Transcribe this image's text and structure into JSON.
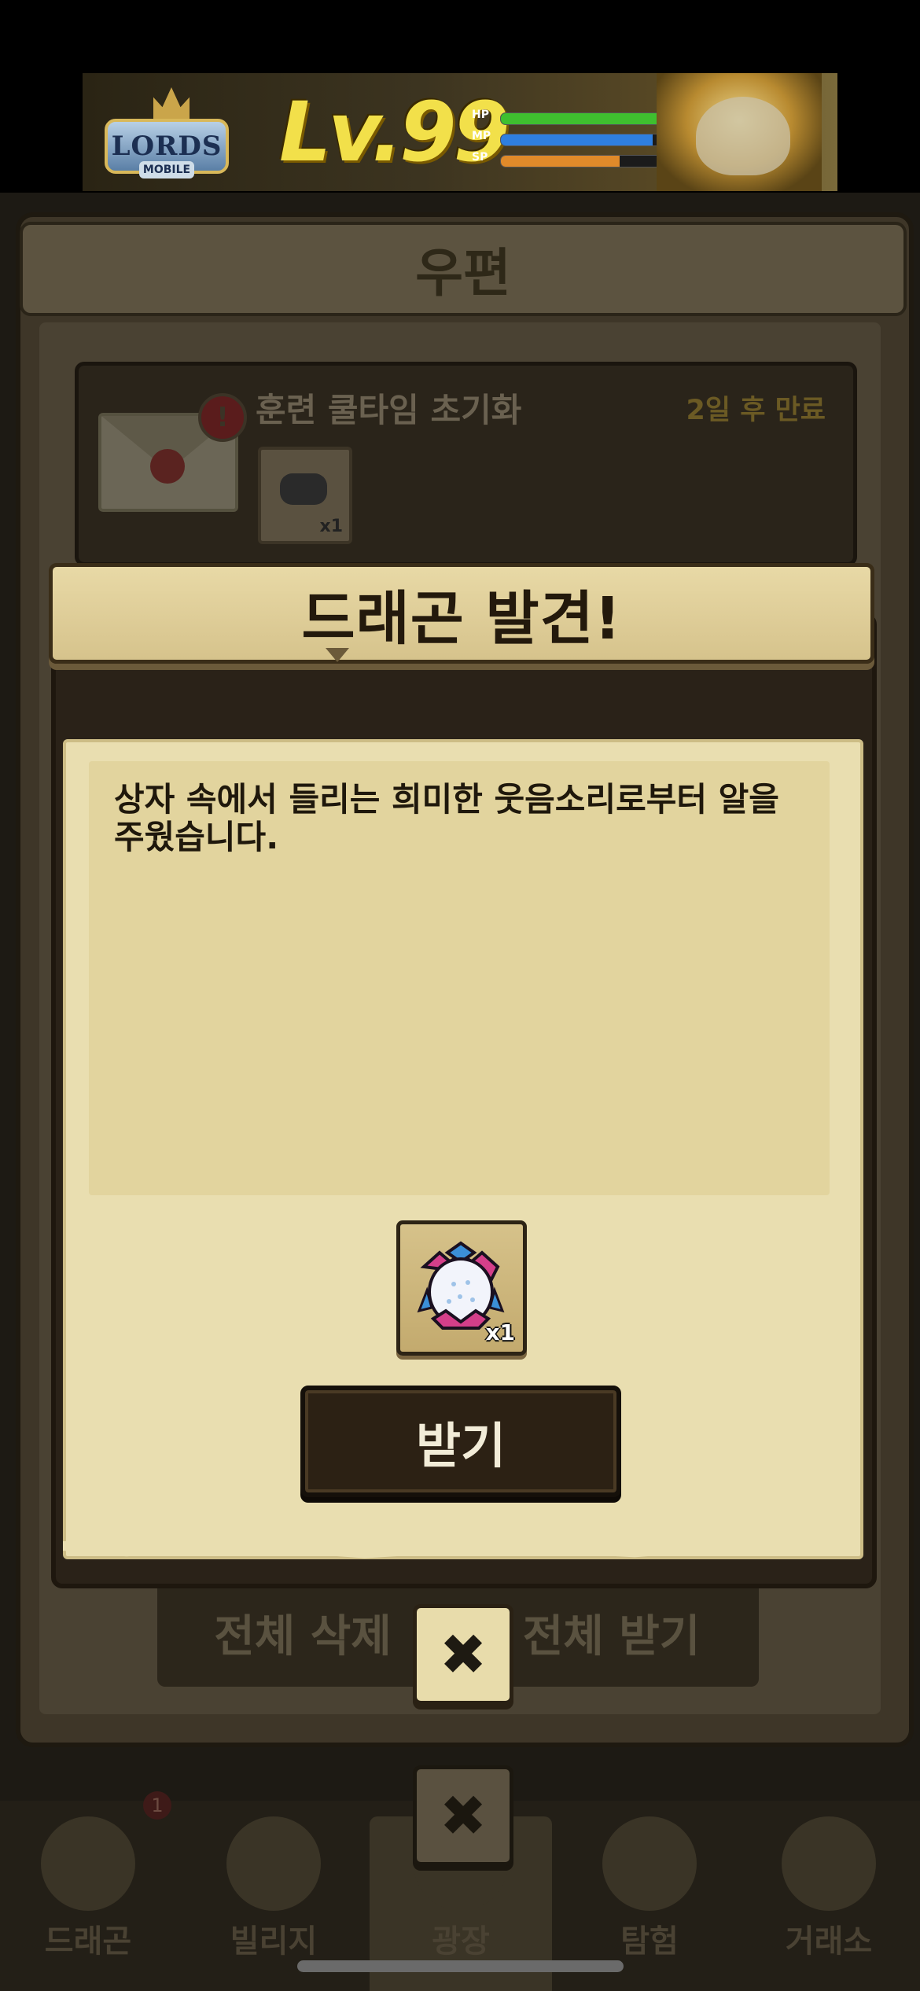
{
  "ad": {
    "logo_text": "LORDS",
    "logo_sub": "MOBILE",
    "level_text": "Lv.99",
    "stats": [
      {
        "label": "HP",
        "fill": 0.95,
        "color": "#3fbf2f"
      },
      {
        "label": "MP",
        "fill": 0.92,
        "color": "#2f7fdf"
      },
      {
        "label": "SP",
        "fill": 0.72,
        "color": "#e08a2a"
      }
    ]
  },
  "mail": {
    "title": "우편",
    "item": {
      "title": "훈련 쿨타임 초기화",
      "expiry": "2일 후 만료",
      "alert_icon": "!",
      "reward_qty": "x1"
    },
    "buttons": {
      "delete_all": "전체 삭제",
      "receive_all": "전체 받기"
    }
  },
  "popup": {
    "title": "드래곤 발견!",
    "message": "상자 속에서 들리는 희미한 웃음소리로부터 알을 주웠습니다.",
    "reward": {
      "icon": "dragon-egg-icon",
      "qty": "x1"
    },
    "receive_label": "받기",
    "close_icon": "✖"
  },
  "nav": {
    "items": [
      {
        "label": "드래곤",
        "icon": "dragon-icon"
      },
      {
        "label": "빌리지",
        "icon": "village-icon"
      },
      {
        "label": "광장",
        "icon": "plaza-icon"
      },
      {
        "label": "탐험",
        "icon": "compass-icon"
      },
      {
        "label": "거래소",
        "icon": "exchange-icon"
      }
    ],
    "badge": "1",
    "close_icon": "✖"
  }
}
